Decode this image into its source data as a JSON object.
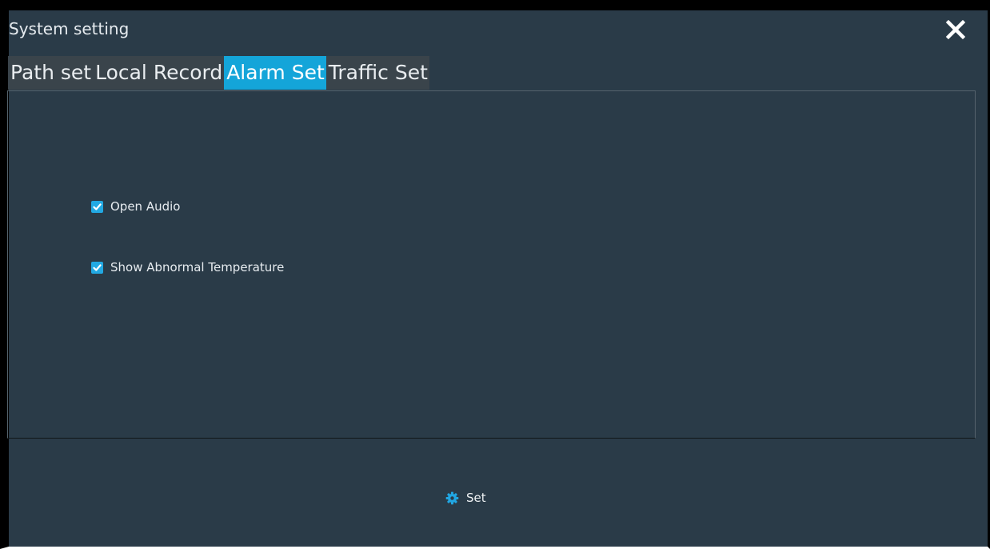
{
  "window": {
    "title": "System setting",
    "close_icon": "close-icon"
  },
  "tabs": [
    {
      "label": "Path set",
      "active": false
    },
    {
      "label": "Local Record",
      "active": false
    },
    {
      "label": "Alarm Set",
      "active": true
    },
    {
      "label": "Traffic Set",
      "active": false
    }
  ],
  "options": [
    {
      "label": "Open Audio",
      "checked": true
    },
    {
      "label": "Show Abnormal Temperature",
      "checked": true
    }
  ],
  "actions": {
    "set_label": "Set",
    "set_icon": "gear-icon"
  },
  "colors": {
    "background": "#2a3b48",
    "tab_active": "#14a5d9",
    "tab_inactive": "#3a444b",
    "checkbox": "#22a9e3",
    "gear": "#21a6e2"
  }
}
